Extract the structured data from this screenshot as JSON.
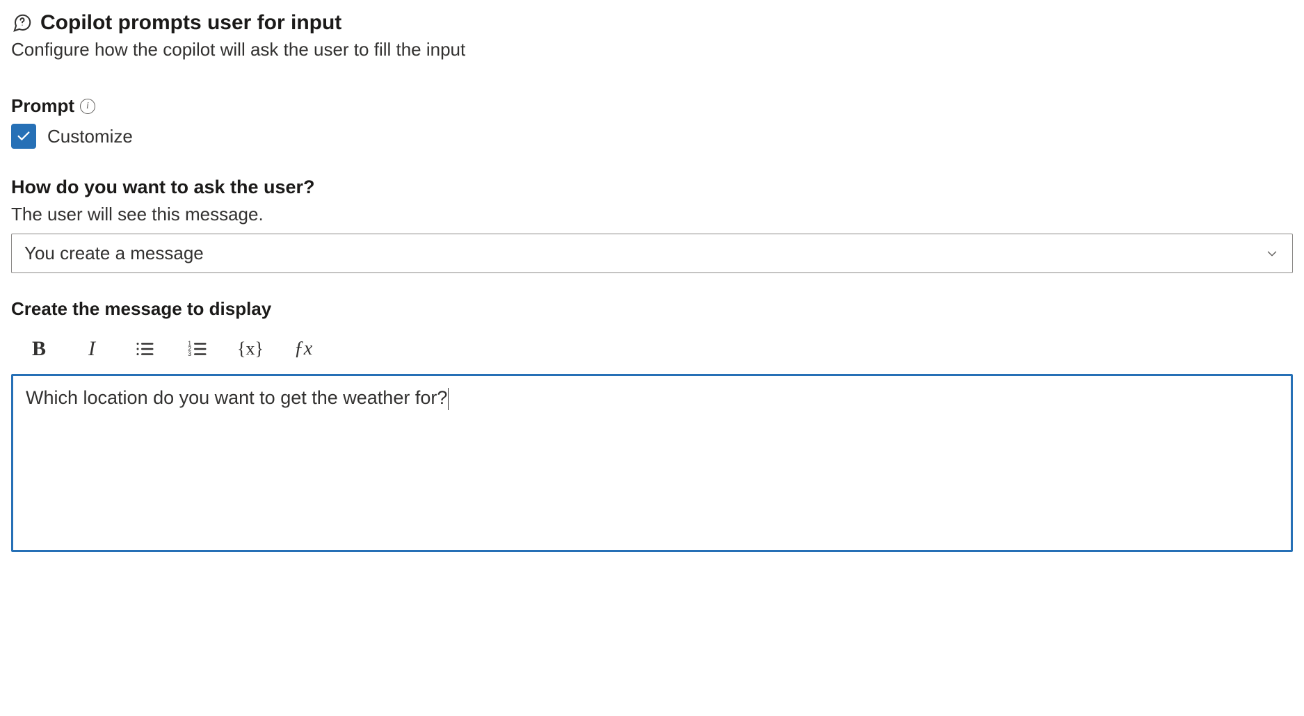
{
  "header": {
    "title": "Copilot prompts user for input",
    "subtitle": "Configure how the copilot will ask the user to fill the input"
  },
  "prompt": {
    "label": "Prompt",
    "customize_label": "Customize",
    "customize_checked": true
  },
  "question": {
    "title": "How do you want to ask the user?",
    "subtitle": "The user will see this message.",
    "select_value": "You create a message"
  },
  "message": {
    "label": "Create the message to display",
    "toolbar": {
      "bold": "B",
      "italic": "I",
      "variable": "{x}",
      "formula": "ƒx"
    },
    "content": "Which location do you want to get the weather for?"
  }
}
